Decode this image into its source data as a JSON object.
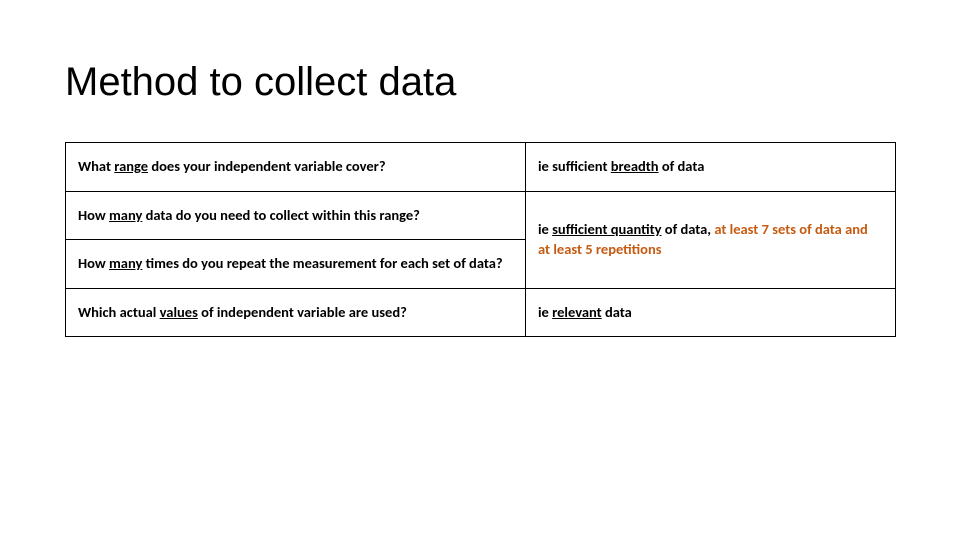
{
  "title": "Method to collect data",
  "rows": {
    "r1": {
      "q_pre": "What ",
      "q_u": "range",
      "q_post": " does your independent variable cover?",
      "a_pre": "ie sufficient ",
      "a_u": "breadth",
      "a_post": " of data"
    },
    "r2a": {
      "q_pre": "How ",
      "q_u": "many",
      "q_post": " data do you need to collect within this range?"
    },
    "r2b": {
      "q_pre": "How ",
      "q_u": "many",
      "q_post": " times do you repeat the measurement for each set of data?"
    },
    "r2ans": {
      "a_pre": "ie ",
      "a_u": "sufficient quantity",
      "a_mid": " of data, ",
      "a_orange": "at least 7 sets of data and at least 5 repetitions"
    },
    "r3": {
      "q_pre": "Which actual ",
      "q_u": "values",
      "q_post": " of independent variable are used?",
      "a_pre": "ie ",
      "a_u": "relevant",
      "a_post": " data"
    }
  }
}
